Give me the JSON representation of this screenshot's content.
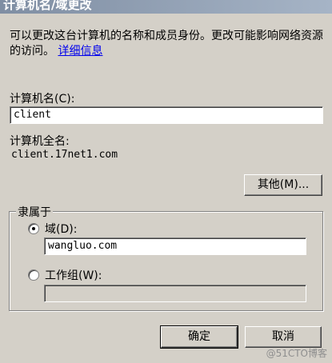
{
  "window": {
    "title": "计算机名/域更改"
  },
  "description": {
    "text": "可以更改这台计算机的名称和成员身份。更改可能影响网络资源的访问。",
    "link": "详细信息"
  },
  "computer_name": {
    "label": "计算机名(C):",
    "value": "client"
  },
  "full_name": {
    "label": "计算机全名:",
    "value": "client.17net1.com"
  },
  "other_button": "其他(M)...",
  "member_of": {
    "legend": "隶属于",
    "domain_label": "域(D):",
    "domain_value": "wangluo.com",
    "domain_selected": true,
    "workgroup_label": "工作组(W):",
    "workgroup_value": "",
    "workgroup_selected": false
  },
  "buttons": {
    "ok": "确定",
    "cancel": "取消"
  },
  "watermark": "@51CTO博客"
}
